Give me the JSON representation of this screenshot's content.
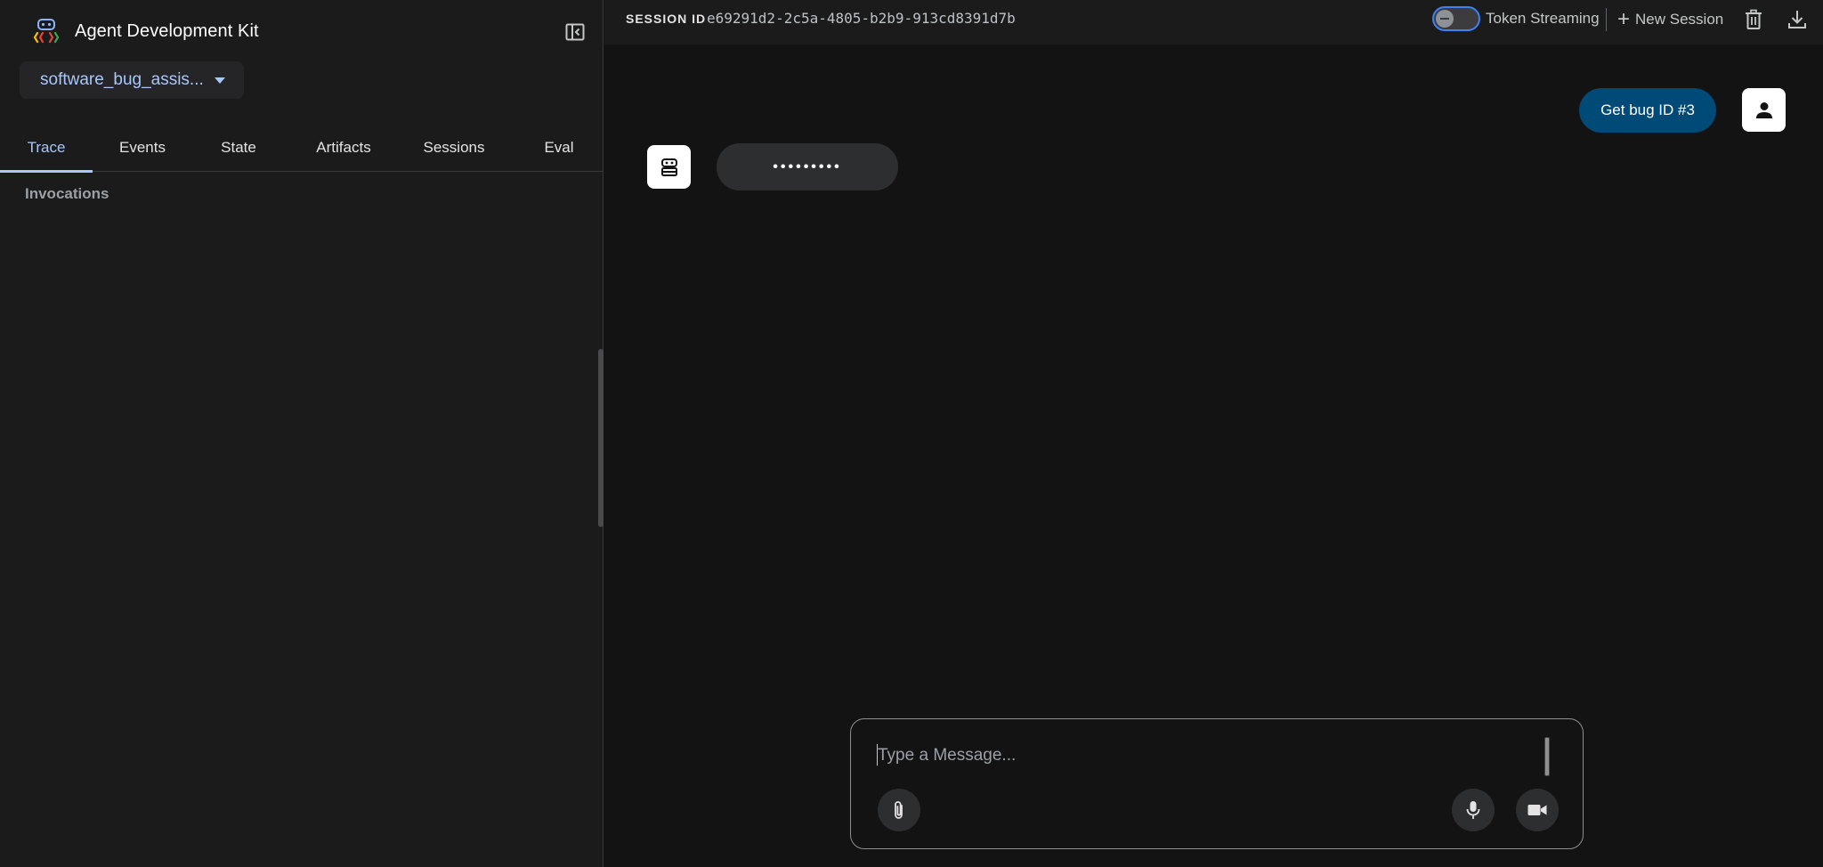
{
  "app": {
    "title": "Agent Development Kit"
  },
  "sidebar": {
    "agent_selector": {
      "value": "software_bug_assis..."
    },
    "tabs": [
      {
        "label": "Trace",
        "active": true
      },
      {
        "label": "Events",
        "active": false
      },
      {
        "label": "State",
        "active": false
      },
      {
        "label": "Artifacts",
        "active": false
      },
      {
        "label": "Sessions",
        "active": false
      },
      {
        "label": "Eval",
        "active": false
      }
    ],
    "section_label": "Invocations"
  },
  "topbar": {
    "session_id_label": "SESSION ID",
    "session_id_value": "e69291d2-2c5a-4805-b2b9-913cd8391d7b",
    "token_streaming_label": "Token Streaming",
    "token_streaming_enabled": false,
    "new_session_label": "New Session"
  },
  "chat": {
    "messages": [
      {
        "role": "user",
        "text": "Get bug ID #3"
      },
      {
        "role": "bot",
        "text": "•••••••••"
      }
    ]
  },
  "composer": {
    "placeholder": "Type a Message...",
    "value": ""
  },
  "colors": {
    "accent": "#a8c7fa",
    "user_bubble": "#004a77",
    "background": "#131314",
    "sidebar": "#1b1b1c"
  },
  "icons": {
    "logo": "adk-logo-icon",
    "collapse": "sidebar-collapse-icon",
    "delete": "trash-icon",
    "download": "download-icon",
    "attach": "paperclip-icon",
    "mic": "microphone-icon",
    "video": "video-camera-icon"
  }
}
